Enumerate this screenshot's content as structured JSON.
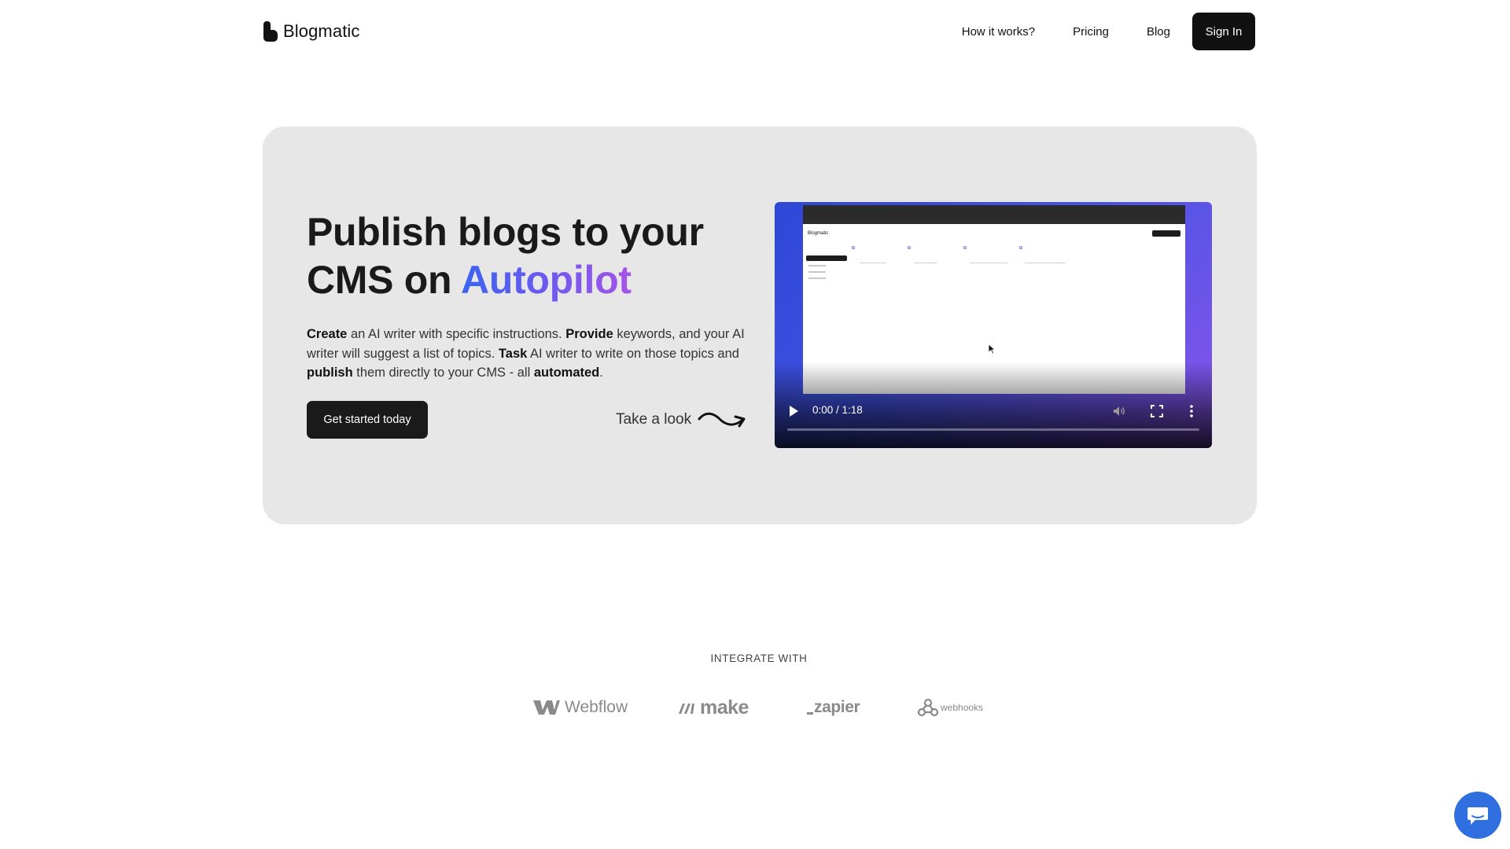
{
  "header": {
    "brand_name": "Blogmatic",
    "nav": [
      {
        "label": "How it works?"
      },
      {
        "label": "Pricing"
      },
      {
        "label": "Blog"
      }
    ],
    "signin_label": "Sign In"
  },
  "hero": {
    "title_line1": "Publish blogs to your",
    "title_line2_prefix": "CMS on ",
    "title_accent": "Autopilot",
    "description": {
      "w1": "Create",
      "t1": " an AI writer with specific instructions. ",
      "w2": "Provide",
      "t2": " keywords, and your AI writer will suggest a list of topics. ",
      "w3": "Task",
      "t3": " AI writer to write on those topics and ",
      "w4": "publish",
      "t4": " them directly to your CMS - all ",
      "w5": "automated",
      "t5": "."
    },
    "cta_label": "Get started today",
    "take_look_label": "Take a look"
  },
  "video": {
    "time": "0:00 / 1:18",
    "progress": 0,
    "inner_brand": "Blogmatic"
  },
  "integrations": {
    "label": "INTEGRATE WITH",
    "logos": [
      {
        "name": "Webflow"
      },
      {
        "name": "make"
      },
      {
        "name": "zapier"
      },
      {
        "name": "webhooks"
      }
    ]
  },
  "colors": {
    "accent_start": "#3a64f0",
    "accent_end": "#a653e6",
    "chat_button": "#2f6fe0",
    "dark_button": "#1a1a1a",
    "hero_bg": "#e7e7e7"
  },
  "icons": {
    "chat": "chat-bubble-icon",
    "play": "play-icon",
    "volume": "volume-icon",
    "fullscreen": "fullscreen-icon",
    "more": "more-vertical-icon",
    "arrow": "curly-arrow-icon"
  }
}
